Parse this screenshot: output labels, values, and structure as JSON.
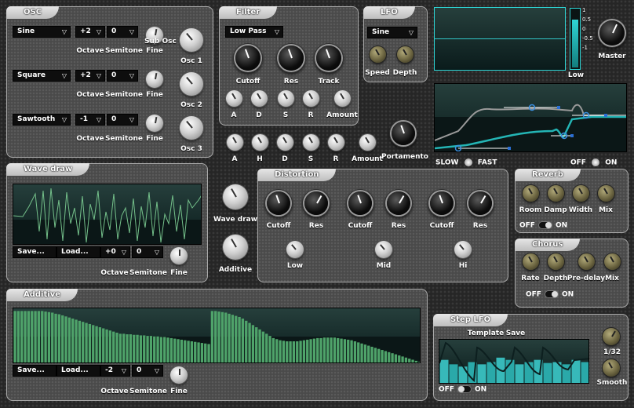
{
  "osc": {
    "title": "OSC",
    "rows": [
      {
        "wave": "Sine",
        "octave": "+2",
        "semitone": "0",
        "knob_label": "Osc 1"
      },
      {
        "wave": "Square",
        "octave": "+2",
        "semitone": "0",
        "knob_label": "Osc 2"
      },
      {
        "wave": "Sawtooth",
        "octave": "-1",
        "semitone": "0",
        "knob_label": "Osc 3"
      }
    ],
    "sub_label": "Sub Osc",
    "octave_label": "Octave",
    "semitone_label": "Semitone",
    "fine_label": "Fine"
  },
  "filter": {
    "title": "Filter",
    "type": "Low Pass",
    "cutoff": "Cutoff",
    "res": "Res",
    "track": "Track",
    "a": "A",
    "d": "D",
    "s": "S",
    "r": "R",
    "amount": "Amount"
  },
  "lfo": {
    "title": "LFO",
    "wave": "Sine",
    "speed": "Speed",
    "depth": "Depth"
  },
  "env2": {
    "a": "A",
    "h": "H",
    "d": "D",
    "s": "S",
    "r": "R",
    "amount": "Amount"
  },
  "portamento": "Portamento",
  "master": {
    "label": "Master",
    "low_label": "Low",
    "meter_ticks": [
      "1",
      "0.5",
      "0",
      "-0.5",
      "-1"
    ],
    "level": 0.82
  },
  "glide": {
    "slow": "SLOW",
    "fast": "FAST",
    "off": "OFF",
    "on": "ON"
  },
  "wavedraw": {
    "title": "Wave draw",
    "save": "Save...",
    "load": "Load...",
    "octave": "+0",
    "semitone": "0",
    "octave_label": "Octave",
    "semitone_label": "Semitone",
    "fine_label": "Fine",
    "knob_wave": "Wave draw",
    "knob_add": "Additive"
  },
  "distortion": {
    "title": "Distortion",
    "groups": [
      {
        "cutoff": "Cutoff",
        "res": "Res",
        "band": "Low"
      },
      {
        "cutoff": "Cutoff",
        "res": "Res",
        "band": "Mid"
      },
      {
        "cutoff": "Cutoff",
        "res": "Res",
        "band": "Hi"
      }
    ]
  },
  "reverb": {
    "title": "Reverb",
    "room": "Room",
    "damp": "Damp",
    "width": "Width",
    "mix": "Mix",
    "off": "OFF",
    "on": "ON"
  },
  "chorus": {
    "title": "Chorus",
    "rate": "Rate",
    "depth": "Depth",
    "predelay": "Pre-delay",
    "mix": "Mix",
    "off": "OFF",
    "on": "ON"
  },
  "additive": {
    "title": "Additive",
    "save": "Save...",
    "load": "Load...",
    "octave": "-2",
    "semitone": "0",
    "octave_label": "Octave",
    "semitone_label": "Semitone",
    "fine_label": "Fine",
    "bars": [
      0.98,
      0.98,
      0.98,
      0.98,
      0.98,
      0.98,
      0.98,
      0.98,
      0.98,
      0.97,
      0.96,
      0.95,
      0.93,
      0.92,
      0.9,
      0.88,
      0.86,
      0.84,
      0.82,
      0.8,
      0.78,
      0.76,
      0.74,
      0.72,
      0.7,
      0.68,
      0.66,
      0.64,
      0.62,
      0.6,
      0.58,
      0.56,
      0.56,
      0.55,
      0.55,
      0.54,
      0.54,
      0.53,
      0.53,
      0.52,
      0.52,
      0.51,
      0.51,
      0.5,
      0.5,
      0.49,
      0.48,
      0.47,
      0.46,
      0.45,
      0.44,
      0.43,
      0.42,
      0.41,
      0.4,
      0.39,
      0.38,
      0.37,
      0.98,
      0.98,
      0.97,
      0.96,
      0.95,
      0.93,
      0.91,
      0.89,
      0.87,
      0.84,
      0.8,
      0.76,
      0.72,
      0.68,
      0.64,
      0.6,
      0.56,
      0.52,
      0.48,
      0.46,
      0.44,
      0.43,
      0.42,
      0.42,
      0.42,
      0.42,
      0.43,
      0.44,
      0.45,
      0.46,
      0.47,
      0.48,
      0.48,
      0.49,
      0.49,
      0.49,
      0.49,
      0.48,
      0.47,
      0.46,
      0.45,
      0.44,
      0.42,
      0.4,
      0.38,
      0.36,
      0.34,
      0.32,
      0.3,
      0.28,
      0.26,
      0.24,
      0.22,
      0.2,
      0.18,
      0.16,
      0.14,
      0.12,
      0.1,
      0.08,
      0.06,
      0.04
    ]
  },
  "steplfo": {
    "title": "Step LFO",
    "template": "Template",
    "save": "Save",
    "rate": "1/32",
    "smooth": "Smooth",
    "off": "OFF",
    "on": "ON"
  }
}
